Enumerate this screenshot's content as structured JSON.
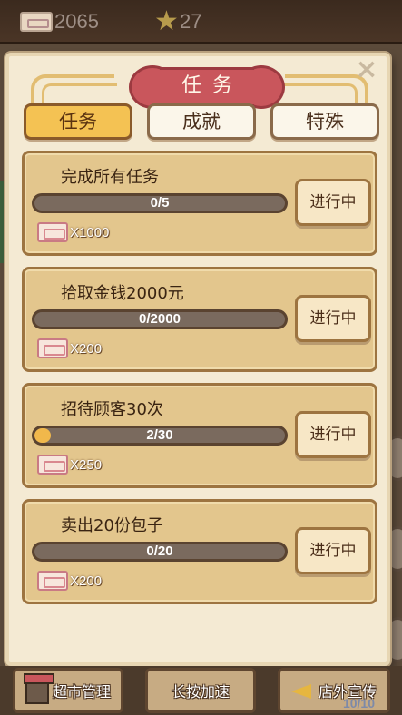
{
  "hud": {
    "tickets": "2065",
    "stars": "27"
  },
  "panel": {
    "title": "任务",
    "close": "×"
  },
  "tabs": [
    {
      "label": "任务",
      "active": true
    },
    {
      "label": "成就",
      "active": false
    },
    {
      "label": "特殊",
      "active": false
    }
  ],
  "tasks": [
    {
      "title": "完成所有任务",
      "progress": "0/5",
      "fraction": 0.0,
      "reward": "X1000",
      "status": "进行中"
    },
    {
      "title": "拾取金钱2000元",
      "progress": "0/2000",
      "fraction": 0.0,
      "reward": "X200",
      "status": "进行中"
    },
    {
      "title": "招待顾客30次",
      "progress": "2/30",
      "fraction": 0.0667,
      "reward": "X250",
      "status": "进行中"
    },
    {
      "title": "卖出20份包子",
      "progress": "0/20",
      "fraction": 0.0,
      "reward": "X200",
      "status": "进行中"
    }
  ],
  "bottom": {
    "market": "超市管理",
    "speedup": "长按加速",
    "promo": "店外宣传",
    "promo_count": "10/10"
  },
  "colors": {
    "accent_tab": "#f4c253",
    "title_red": "#c9565c",
    "progress_fill": "#f1b84b"
  }
}
